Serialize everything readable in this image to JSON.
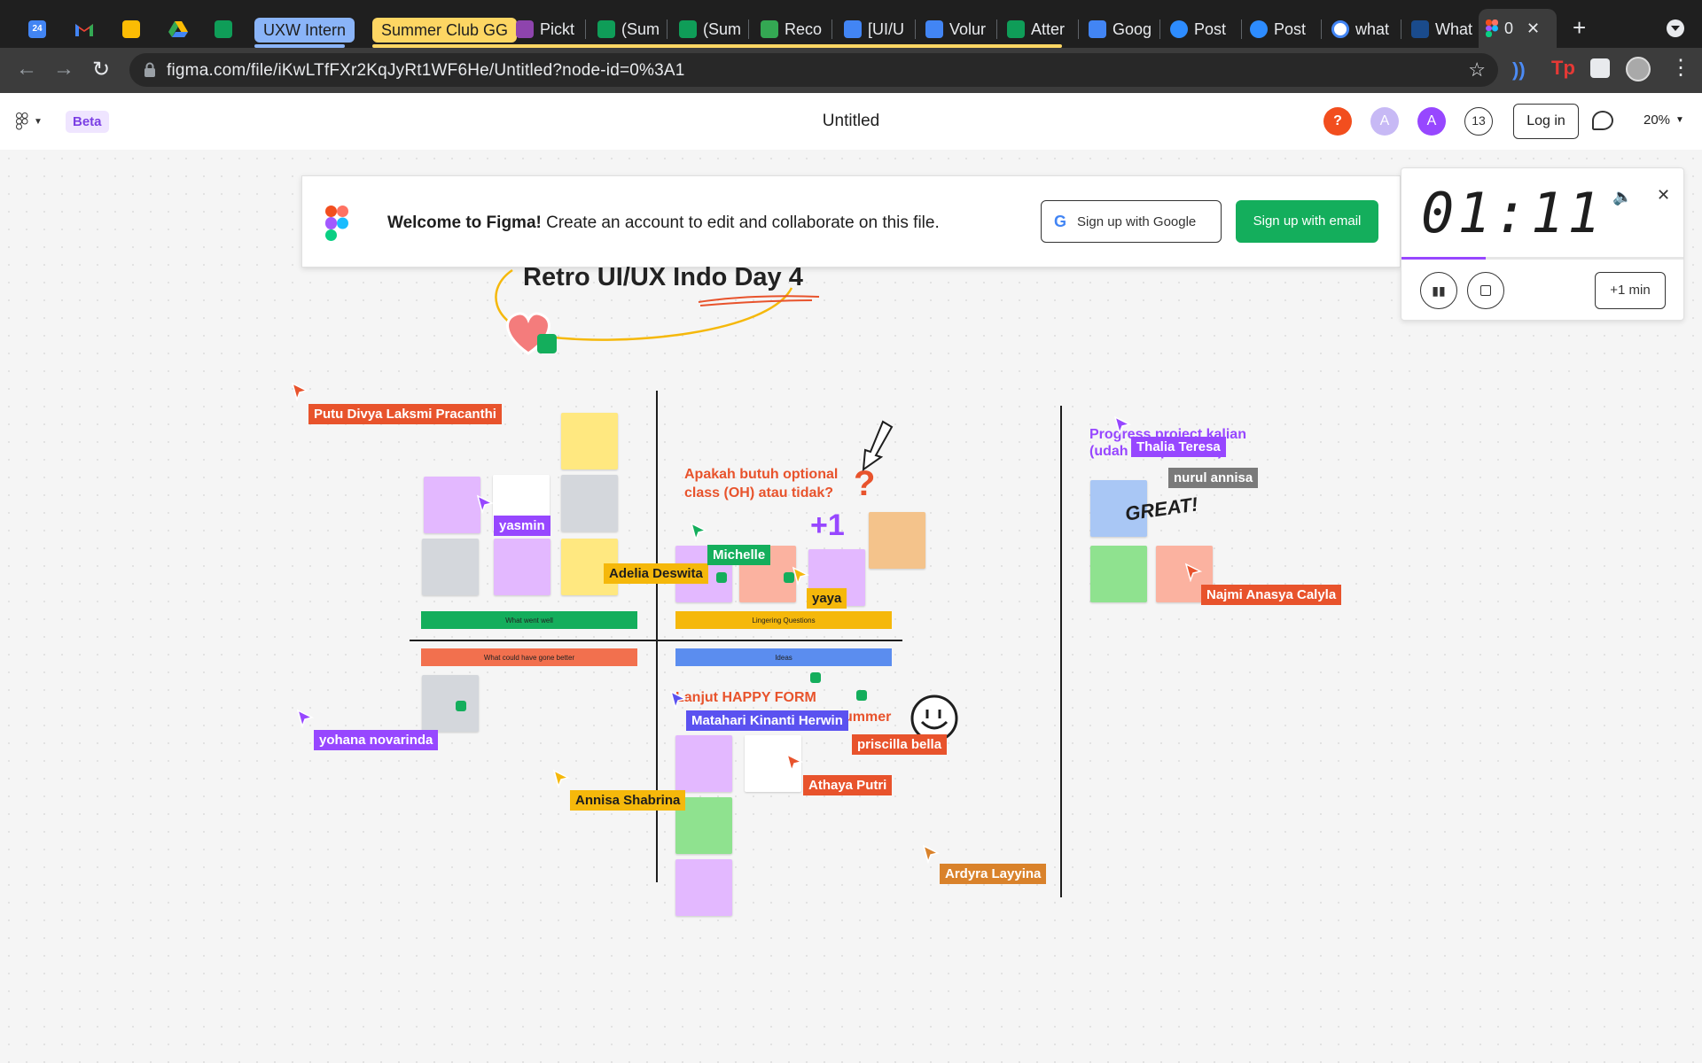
{
  "browser": {
    "tabs": [
      {
        "label": "",
        "icon": "calendar-icon",
        "color": "#4285f4"
      },
      {
        "label": "",
        "icon": "gmail-icon",
        "color": "#ea4335"
      },
      {
        "label": "",
        "icon": "slides-icon",
        "color": "#fbbc04"
      },
      {
        "label": "",
        "icon": "drive-icon",
        "color": "#34a853"
      },
      {
        "label": "",
        "icon": "sheets-icon",
        "color": "#0f9d58"
      },
      {
        "label": "UXW Intern",
        "group": true
      },
      {
        "label": "Summer Club GG",
        "group": true
      },
      {
        "label": "Pickt",
        "icon": "pickt-icon",
        "color": "#8e44ad"
      },
      {
        "label": "(Sum",
        "icon": "sheets-icon",
        "color": "#0f9d58"
      },
      {
        "label": "(Sum",
        "icon": "sheets-icon",
        "color": "#0f9d58"
      },
      {
        "label": "Reco",
        "icon": "drive-icon",
        "color": "#34a853"
      },
      {
        "label": "[UI/U",
        "icon": "docs-icon",
        "color": "#4285f4"
      },
      {
        "label": "Volur",
        "icon": "docs-icon",
        "color": "#4285f4"
      },
      {
        "label": "Atter",
        "icon": "sheets-icon",
        "color": "#0f9d58"
      },
      {
        "label": "Goog",
        "icon": "translate-icon",
        "color": "#4285f4"
      },
      {
        "label": "Post",
        "icon": "zoom-icon",
        "color": "#2d8cff"
      },
      {
        "label": "Post",
        "icon": "zoom-icon",
        "color": "#2d8cff"
      },
      {
        "label": "what",
        "icon": "google-icon",
        "color": "#ffffff"
      },
      {
        "label": "What",
        "icon": "cdc-icon",
        "color": "#1a4b8c"
      },
      {
        "label": "0",
        "icon": "figma-icon",
        "color": "#f24e1e",
        "active": true
      }
    ],
    "url": "figma.com/file/iKwLTfFXr2KqJyRt1WF6He/Untitled?node-id=0%3A1"
  },
  "figma": {
    "beta_label": "Beta",
    "file_title": "Untitled",
    "avatars": [
      "?",
      "A",
      "A"
    ],
    "viewer_count": "13",
    "login_label": "Log in",
    "zoom_label": "20%"
  },
  "welcome": {
    "bold": "Welcome to Figma!",
    "text": " Create an account to edit and collaborate on this file.",
    "google_button": "Sign up with Google",
    "email_button": "Sign up with email"
  },
  "timer": {
    "time": "01:11",
    "add_min": "+1 min"
  },
  "board": {
    "title": "Retro UI/UX Indo Day 4",
    "sections": {
      "went_well": "What went well",
      "lingering": "Lingering Questions",
      "gone_better": "What could have gone better",
      "ideas": "Ideas"
    },
    "question": "Apakah butuh optional class (OH) atau tidak?",
    "plus_one": "+1",
    "great": "GREAT!",
    "progress": "Progress project kalian (udah sampe mana)",
    "happy_form_line1": "Lanjut HAPPY FORM",
    "happy_form_line2": "ummer"
  },
  "cursors": [
    {
      "name": "Putu Divya Laksmi Pracanthi",
      "color": "#e8532c"
    },
    {
      "name": "yasmin",
      "color": "#9747ff"
    },
    {
      "name": "Adelia Deswita",
      "color": "#f5b80b"
    },
    {
      "name": "Michelle",
      "color": "#14a562"
    },
    {
      "name": "yaya",
      "color": "#f5b80b"
    },
    {
      "name": "Thalia Teresa",
      "color": "#9747ff"
    },
    {
      "name": "nurul annisa",
      "color": "#7a7a7a"
    },
    {
      "name": "Najmi Anasya Calyla",
      "color": "#e8532c"
    },
    {
      "name": "yohana novarinda",
      "color": "#9747ff"
    },
    {
      "name": "Matahari Kinanti Herwin",
      "color": "#5b52f0"
    },
    {
      "name": "priscilla bella",
      "color": "#e8532c"
    },
    {
      "name": "Athaya Putri",
      "color": "#e8532c"
    },
    {
      "name": "Annisa Shabrina",
      "color": "#f5b80b"
    },
    {
      "name": "Ardyra Layyina",
      "color": "#d9822b"
    }
  ]
}
